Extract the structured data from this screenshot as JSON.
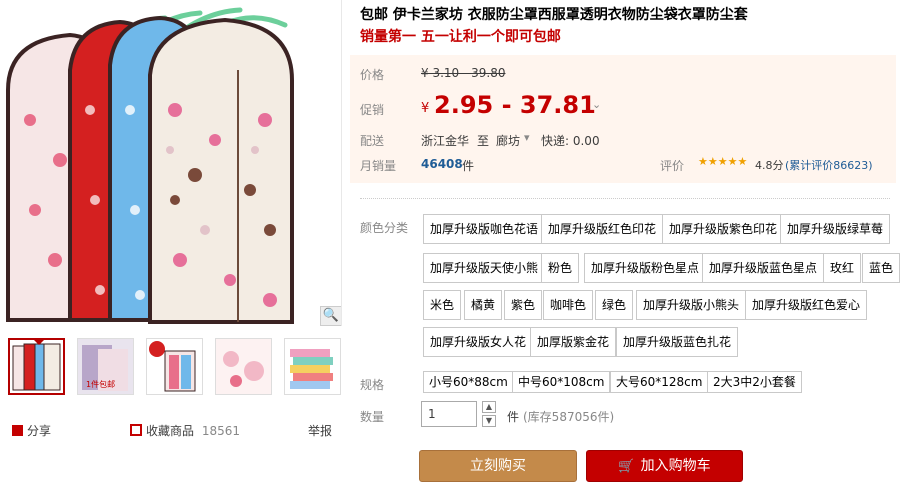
{
  "product": {
    "title": "包邮 伊卡兰家坊 衣服防尘罩西服罩透明衣物防尘袋衣罩防尘套",
    "promo": "销量第一 五一让利一个即可包邮"
  },
  "price": {
    "label": "价格",
    "original": "¥ 3.10 - 39.80",
    "promo_label": "促销",
    "promo_currency": "¥",
    "promo_price": "2.95 - 37.81",
    "promo_caret": "⌄"
  },
  "shipping": {
    "label": "配送",
    "from": "浙江金华",
    "to_word": "至",
    "to_city": "廊坊",
    "caret": "▾",
    "express": "快递: 0.00"
  },
  "sales": {
    "label": "月销量",
    "count": "46408",
    "unit": "件",
    "rating_label": "评价",
    "stars": "★★★★★",
    "rating": "4.8分",
    "rating_count": "(累计评价86623)"
  },
  "colors": {
    "label": "颜色分类",
    "options": [
      "加厚升级版咖色花语",
      "加厚升级版红色印花",
      "加厚升级版紫色印花",
      "加厚升级版绿草莓",
      "加厚升级版天使小熊",
      "粉色",
      "加厚升级版粉色星点",
      "加厚升级版蓝色星点",
      "玫红",
      "蓝色",
      "米色",
      "橘黄",
      "紫色",
      "咖啡色",
      "绿色",
      "加厚升级版小熊头",
      "加厚升级版红色爱心",
      "加厚升级版女人花",
      "加厚版紫金花",
      "加厚升级版蓝色扎花"
    ]
  },
  "sizes": {
    "label": "规格",
    "options": [
      "小号60*88cm",
      "中号60*108cm",
      "大号60*128cm",
      "2大3中2小套餐"
    ]
  },
  "quantity": {
    "label": "数量",
    "value": "1",
    "unit": "件",
    "stock": "(库存587056件)",
    "up": "▲",
    "down": "▼"
  },
  "actions": {
    "buy_now": "立刻购买",
    "add_to_cart": "加入购物车"
  },
  "share": {
    "share_label": "分享",
    "fav_label": "收藏商品",
    "fav_count": "18561",
    "report_label": "举报"
  },
  "colors_theme": {
    "accent": "#c40000",
    "buy_now": "#c48a4a",
    "cart": "#c40000"
  }
}
